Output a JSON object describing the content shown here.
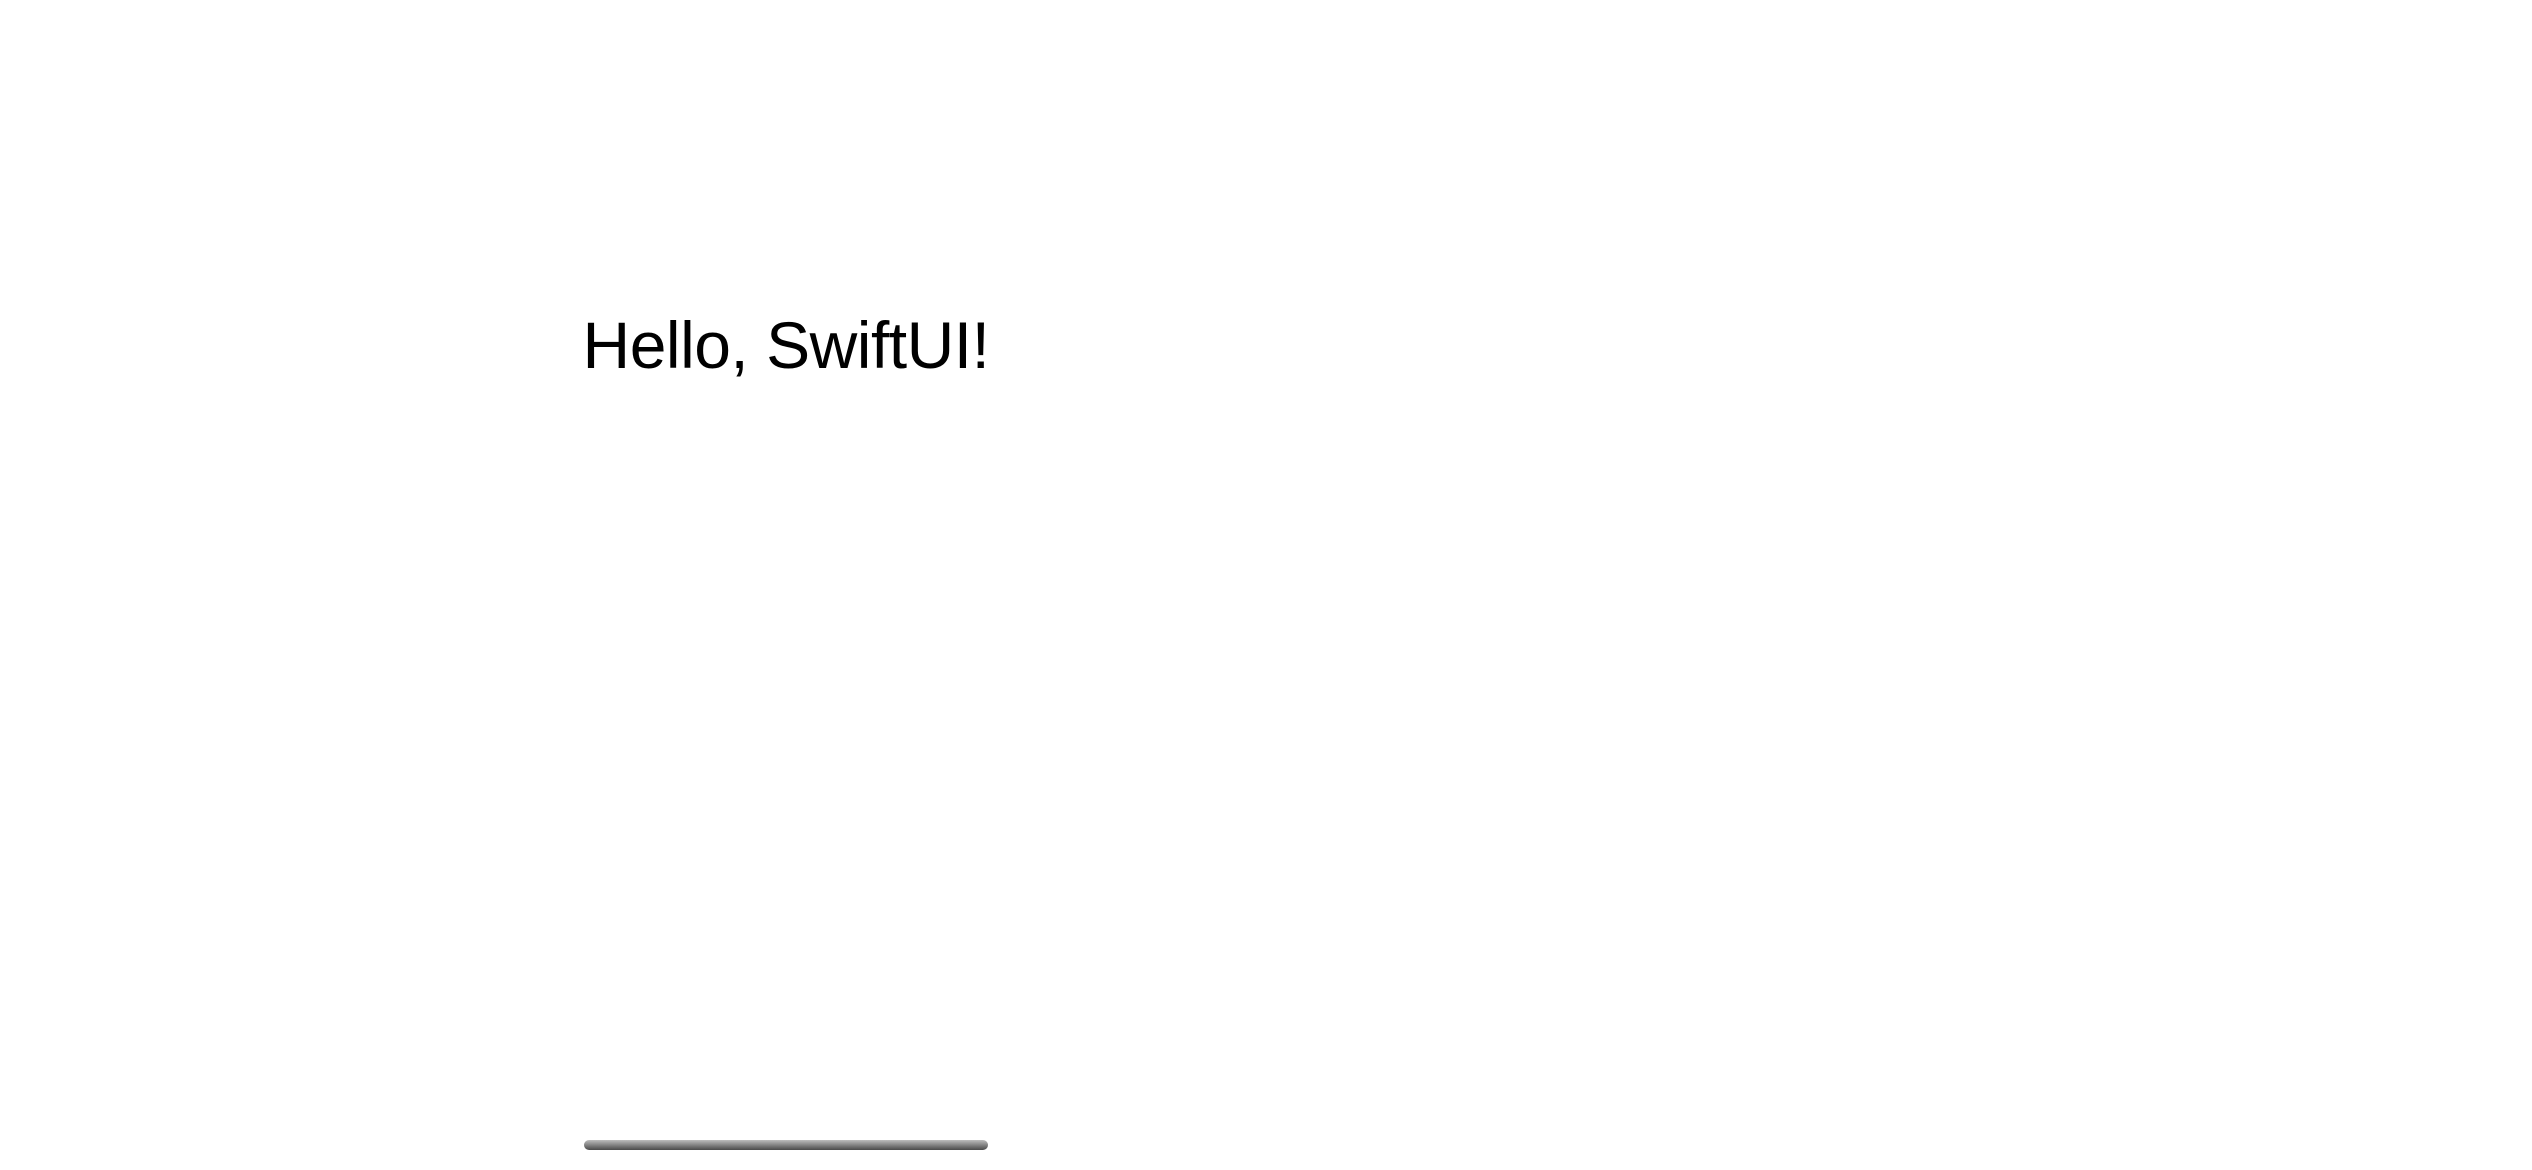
{
  "main": {
    "greeting_text": "Hello, SwiftUI!"
  }
}
